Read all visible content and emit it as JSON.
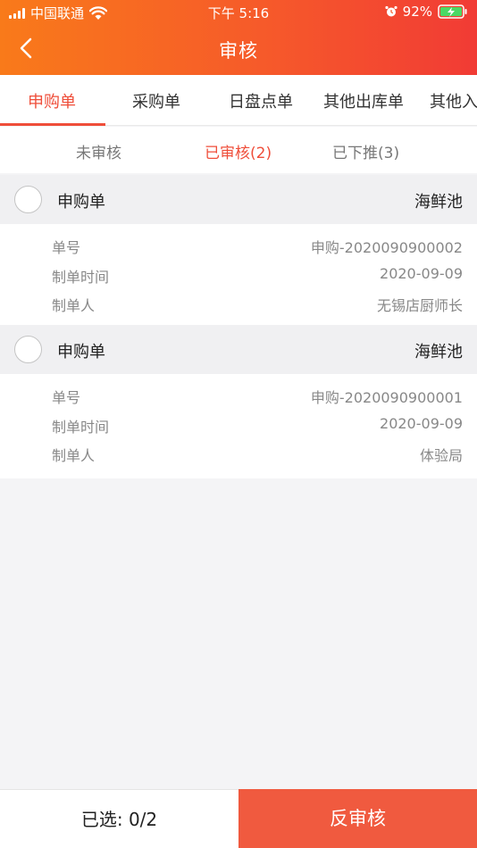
{
  "status_bar": {
    "carrier": "中国联通",
    "time": "下午 5:16",
    "battery": "92%"
  },
  "nav": {
    "title": "审核",
    "back_icon": "chevron-left-icon"
  },
  "tabs": [
    {
      "label": "申购单",
      "active": true
    },
    {
      "label": "采购单",
      "active": false
    },
    {
      "label": "日盘点单",
      "active": false
    },
    {
      "label": "其他出库单",
      "active": false
    },
    {
      "label": "其他入",
      "active": false
    }
  ],
  "subtabs": [
    {
      "label": "未审核",
      "active": false
    },
    {
      "label": "已审核(2)",
      "active": true
    },
    {
      "label": "已下推(3)",
      "active": false
    }
  ],
  "orders": [
    {
      "type": "申购单",
      "dept": "海鲜池",
      "rows": [
        {
          "label": "单号",
          "value": "申购-2020090900002"
        },
        {
          "label": "制单时间",
          "value": "2020-09-09"
        },
        {
          "label": "制单人",
          "value": "无锡店厨师长"
        }
      ]
    },
    {
      "type": "申购单",
      "dept": "海鲜池",
      "rows": [
        {
          "label": "单号",
          "value": "申购-2020090900001"
        },
        {
          "label": "制单时间",
          "value": "2020-09-09"
        },
        {
          "label": "制单人",
          "value": "体验局"
        }
      ]
    }
  ],
  "footer": {
    "selected": "已选: 0/2",
    "action": "反审核"
  },
  "colors": {
    "accent": "#ef4e3a",
    "header_start": "#f97a1a",
    "header_end": "#f13b35",
    "button": "#f05a3f"
  }
}
